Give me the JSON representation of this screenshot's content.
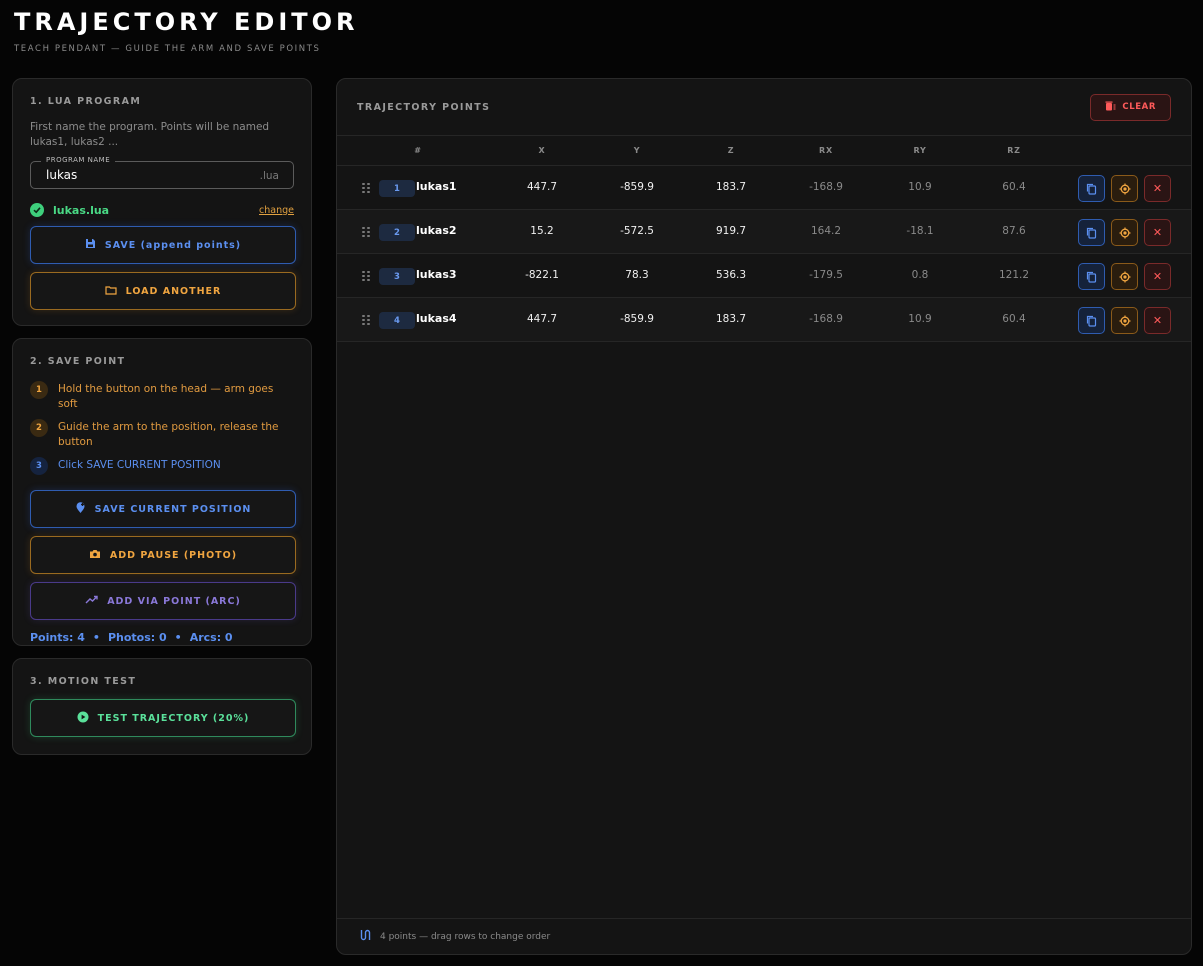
{
  "header": {
    "title": "TRAJECTORY EDITOR",
    "subtitle": "TEACH PENDANT — GUIDE THE ARM AND SAVE POINTS"
  },
  "lua_program": {
    "title": "1. LUA PROGRAM",
    "description": "First name the program. Points will be named lukas1, lukas2 ...",
    "field_label": "PROGRAM NAME",
    "field_value": "lukas",
    "field_suffix": ".lua",
    "filename": "lukas.lua",
    "change_label": "change",
    "save_button": "SAVE (append points)",
    "load_button": "LOAD ANOTHER"
  },
  "save_point": {
    "title": "2. SAVE POINT",
    "steps": [
      {
        "num": "1",
        "text": "Hold the button on the head — arm goes soft"
      },
      {
        "num": "2",
        "text": "Guide the arm to the position, release the button"
      },
      {
        "num": "3",
        "text": "Click SAVE CURRENT POSITION"
      }
    ],
    "save_position_button": "SAVE CURRENT POSITION",
    "add_pause_button": "ADD PAUSE (PHOTO)",
    "add_via_button": "ADD VIA POINT (ARC)",
    "stats": {
      "points": "Points: 4",
      "photos": "Photos: 0",
      "arcs": "Arcs: 0",
      "separator": "•"
    }
  },
  "motion_test": {
    "title": "3. MOTION TEST",
    "test_button": "TEST TRAJECTORY (20%)"
  },
  "points": {
    "title": "TRAJECTORY POINTS",
    "clear_button": "CLEAR",
    "columns": [
      "#",
      "X",
      "Y",
      "Z",
      "RX",
      "RY",
      "RZ"
    ],
    "rows": [
      {
        "index": "1",
        "name": "lukas1",
        "x": "447.7",
        "y": "-859.9",
        "z": "183.7",
        "rx": "-168.9",
        "ry": "10.9",
        "rz": "60.4"
      },
      {
        "index": "2",
        "name": "lukas2",
        "x": "15.2",
        "y": "-572.5",
        "z": "919.7",
        "rx": "164.2",
        "ry": "-18.1",
        "rz": "87.6"
      },
      {
        "index": "3",
        "name": "lukas3",
        "x": "-822.1",
        "y": "78.3",
        "z": "536.3",
        "rx": "-179.5",
        "ry": "0.8",
        "rz": "121.2"
      },
      {
        "index": "4",
        "name": "lukas4",
        "x": "447.7",
        "y": "-859.9",
        "z": "183.7",
        "rx": "-168.9",
        "ry": "10.9",
        "rz": "60.4"
      }
    ],
    "delete_glyph": "✕",
    "footer": "4 points — drag rows to change order"
  },
  "colors": {
    "background": "#050505",
    "panel": "#141414",
    "blue": "#5b8ff0",
    "orange": "#f0a540",
    "purple": "#8a78d8",
    "green": "#5ae09a",
    "red": "#ff5a5a"
  }
}
